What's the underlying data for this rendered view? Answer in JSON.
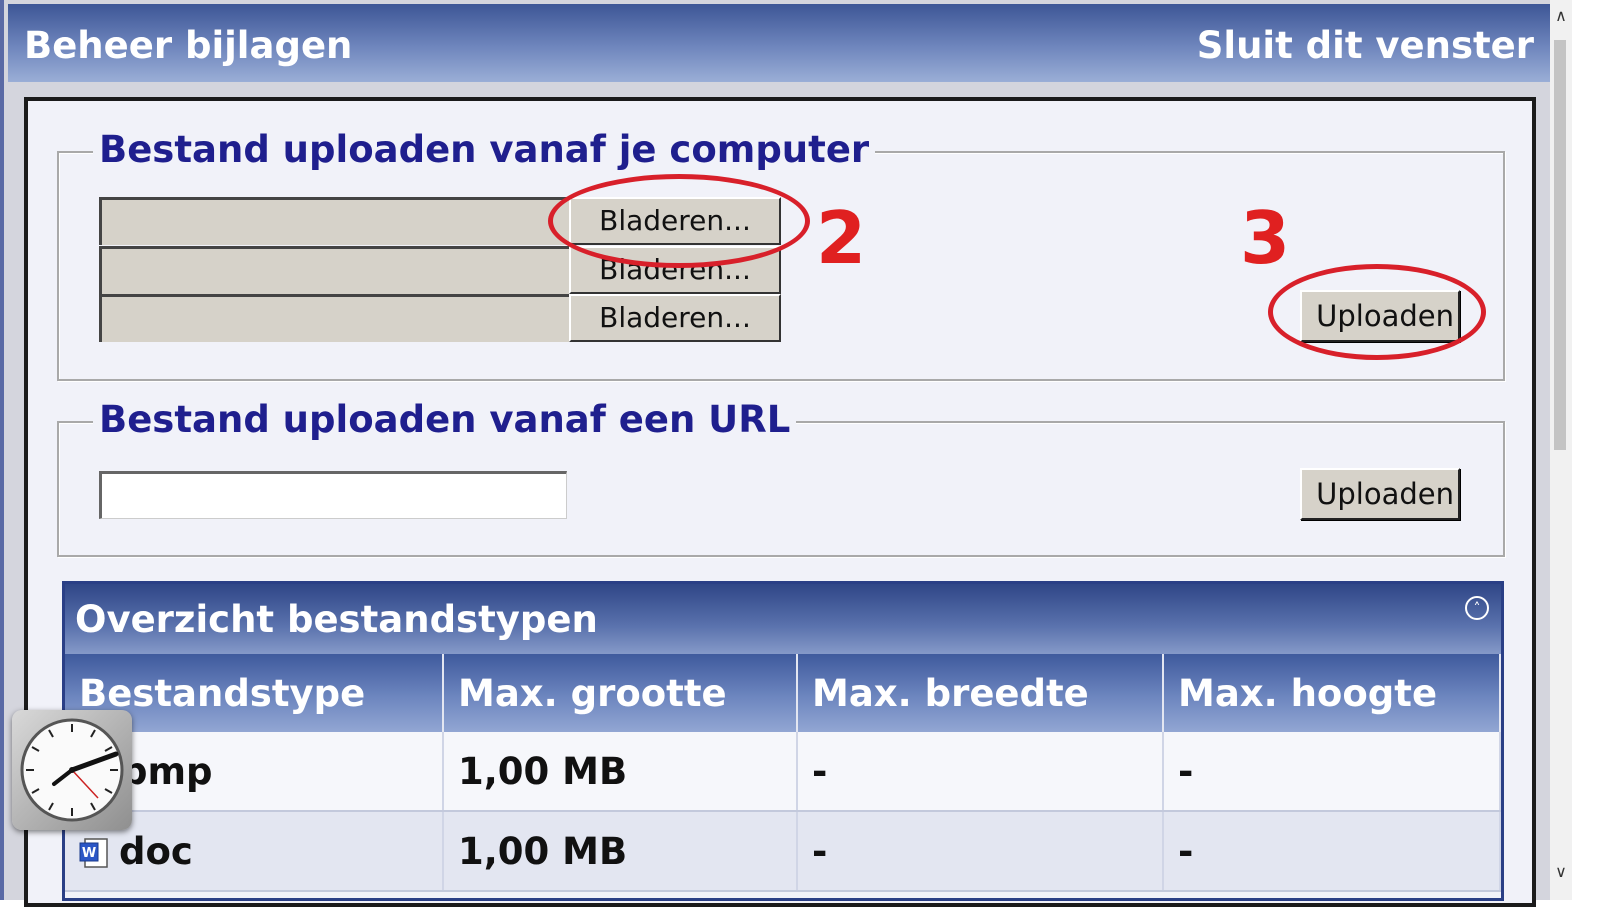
{
  "window": {
    "title": "Beheer bijlagen",
    "close_label": "Sluit dit venster"
  },
  "upload_computer": {
    "legend": "Bestand uploaden vanaf je computer",
    "browse_buttons": [
      "Bladeren...",
      "Bladeren...",
      "Bladeren..."
    ],
    "upload_label": "Uploaden"
  },
  "upload_url": {
    "legend": "Bestand uploaden vanaf een URL",
    "input_value": "",
    "upload_label": "Uploaden"
  },
  "markers": {
    "step2": "2",
    "step3": "3",
    "color": "#e02020"
  },
  "overview": {
    "title": "Overzicht bestandstypen",
    "columns": [
      "Bestandstype",
      "Max. grootte",
      "Max. breedte",
      "Max. hoogte"
    ],
    "rows": [
      {
        "type": "bmp",
        "size": "1,00 MB",
        "width": "-",
        "height": "-"
      },
      {
        "type": "doc",
        "size": "1,00 MB",
        "width": "-",
        "height": "-"
      }
    ]
  },
  "colors": {
    "header_blue": "#3d5696",
    "legend_text": "#1f1f8e",
    "highlight_red": "#d8202a"
  },
  "icons": {
    "collapse": "double-chevron-up-icon",
    "clock": "analog-clock-icon",
    "word_doc": "word-document-icon"
  }
}
